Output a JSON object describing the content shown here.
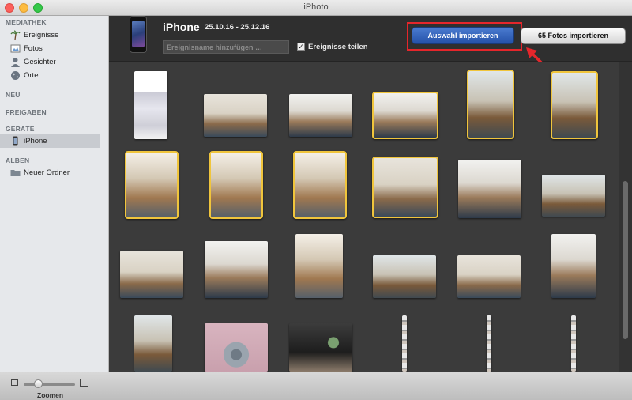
{
  "window": {
    "title": "iPhoto"
  },
  "sidebar": {
    "sections": [
      {
        "title": "MEDIATHEK",
        "items": [
          {
            "label": "Ereignisse",
            "icon": "palm-tree-icon"
          },
          {
            "label": "Fotos",
            "icon": "photo-icon"
          },
          {
            "label": "Gesichter",
            "icon": "person-icon"
          },
          {
            "label": "Orte",
            "icon": "globe-icon"
          }
        ]
      },
      {
        "title": "NEU",
        "items": []
      },
      {
        "title": "FREIGABEN",
        "items": []
      },
      {
        "title": "GERÄTE",
        "items": [
          {
            "label": "iPhone",
            "icon": "iphone-icon",
            "selected": true
          }
        ]
      },
      {
        "title": "ALBEN",
        "items": [
          {
            "label": "Neuer Ordner",
            "icon": "folder-icon"
          }
        ]
      }
    ]
  },
  "header": {
    "device_name": "iPhone",
    "date_range": "25.10.16 - 25.12.16",
    "event_placeholder": "Ereignisname hinzufügen …",
    "share_events_label": "Ereignisse teilen",
    "share_events_checked": true,
    "import_selection_label": "Auswahl importieren",
    "import_all_label": "65 Fotos importieren"
  },
  "colors": {
    "accent": "#2f5fbf",
    "selection": "#f0c53c",
    "highlight": "#e5262b"
  },
  "bottombar": {
    "zoom_label": "Zoomen",
    "zoom_level": 0.28
  }
}
